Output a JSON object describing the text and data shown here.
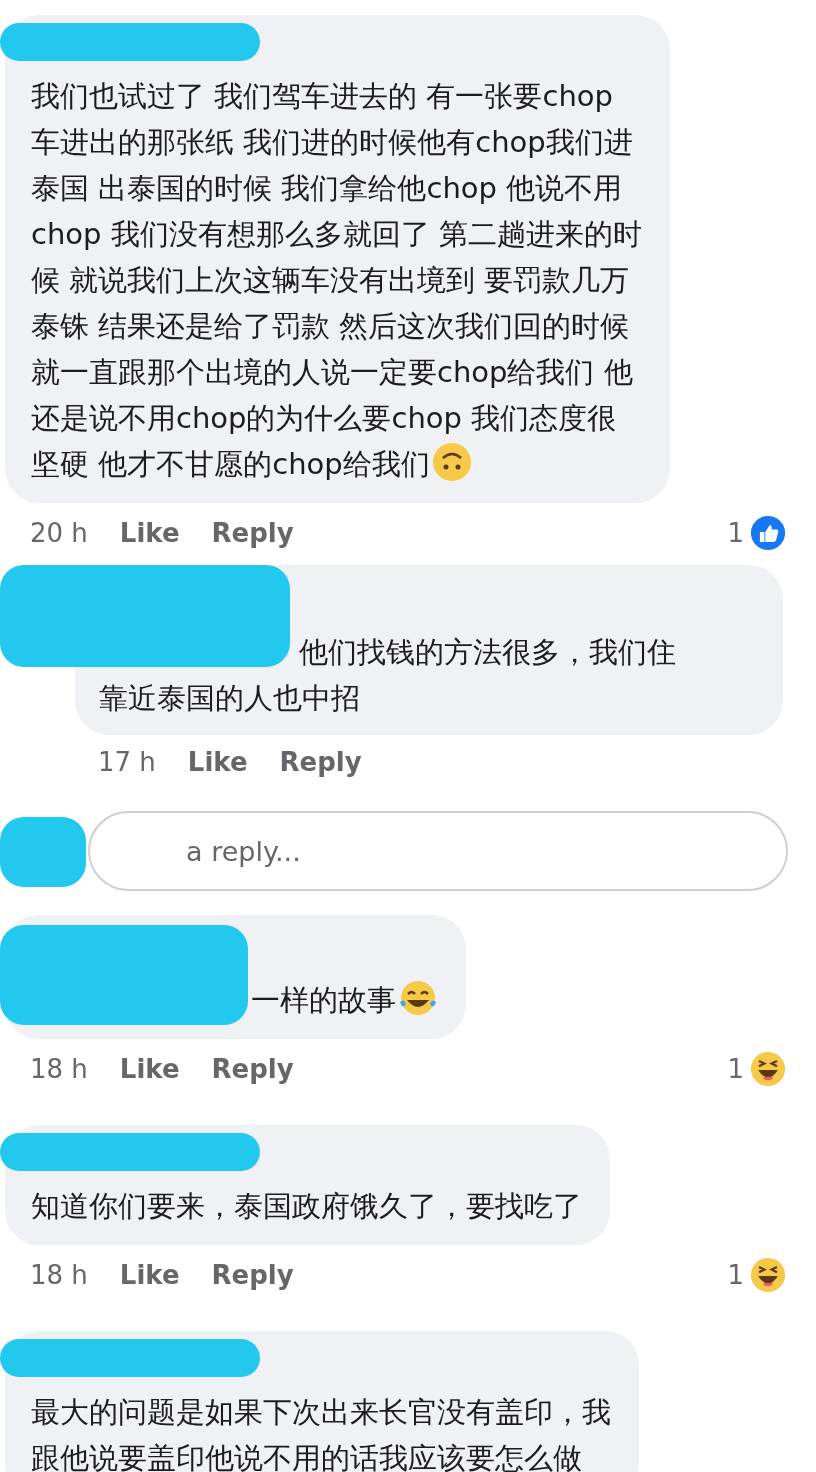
{
  "comments": [
    {
      "kind": "name_line",
      "lines": [
        "我们也试过了 我们驾车进去的 有一张要chop",
        "车进出的那张纸 我们进的时候他有chop我们进",
        "泰国 出泰国的时候 我们拿给他chop 他说不用",
        "chop 我们没有想那么多就回了 第二趟进来的时",
        "候 就说我们上次这辆车没有出境到 要罚款几万",
        "泰铢 结果还是给了罚款 然后这次我们回的时候",
        "就一直跟那个出境的人说一定要chop给我们 他",
        "还是说不用chop的为什么要chop 我们态度很",
        "坚硬 他才不甘愿的chop给我们"
      ],
      "emoji": {
        "kind": "upside-down"
      },
      "time": "20 h",
      "like": "Like",
      "reply": "Reply",
      "reaction": {
        "count": "1",
        "kind": "like"
      },
      "children": [
        {
          "kind": "two_lines",
          "lines": [
            "他们找钱的方法很多，我们住",
            "靠近泰国的人也中招"
          ],
          "time": "17 h",
          "like": "Like",
          "reply": "Reply"
        }
      ],
      "reply_field": {
        "placeholder": "a reply..."
      }
    },
    {
      "kind": "two_lines",
      "lines": [
        "一样的故事"
      ],
      "emoji": {
        "kind": "tears-of-joy"
      },
      "time": "18 h",
      "like": "Like",
      "reply": "Reply",
      "reaction": {
        "count": "1",
        "kind": "haha"
      }
    },
    {
      "kind": "name_line",
      "lines": [
        "知道你们要来，泰国政府饿久了，要找吃了"
      ],
      "time": "18 h",
      "like": "Like",
      "reply": "Reply",
      "reaction": {
        "count": "1",
        "kind": "haha"
      }
    },
    {
      "kind": "name_line",
      "lines": [
        "最大的问题是如果下次出来长官没有盖印，我",
        "跟他说要盖印他说不用的话我应该要怎么做"
      ]
    }
  ]
}
